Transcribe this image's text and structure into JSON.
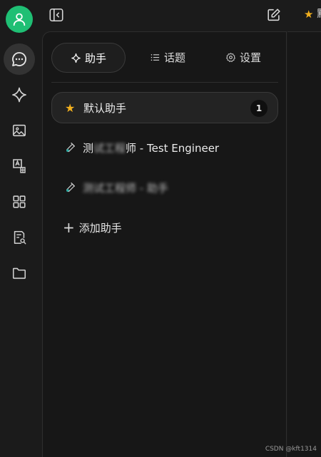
{
  "rail": {
    "items": [
      {
        "icon": "chat-icon",
        "active": true
      },
      {
        "icon": "sparkle-icon"
      },
      {
        "icon": "image-icon"
      },
      {
        "icon": "translate-icon"
      },
      {
        "icon": "apps-grid-icon"
      },
      {
        "icon": "document-search-icon"
      },
      {
        "icon": "folder-icon"
      }
    ]
  },
  "topbar": {
    "current_assistant_star": "★",
    "current_assistant_label_clipped": "默"
  },
  "tabs": [
    {
      "label": "助手",
      "icon": "sparkle-icon",
      "active": true
    },
    {
      "label": "话题",
      "icon": "list-icon"
    },
    {
      "label": "设置",
      "icon": "gear-icon"
    }
  ],
  "assistants": [
    {
      "icon": "★",
      "label": "默认助手",
      "badge": "1",
      "selected": true
    },
    {
      "icon": "test-tube-icon",
      "label_visible_prefix": "测",
      "label_blurred": "试工程",
      "label_visible_suffix": "师 - Test Engineer"
    },
    {
      "icon": "test-tube-icon",
      "label_blurred": "测试工程师 - 助手"
    }
  ],
  "add_assistant_label": "添加助手",
  "watermark": "CSDN @kft1314",
  "colors": {
    "accent_green": "#1fbf74",
    "star_yellow": "#f2b01e",
    "background": "#1b1b1b",
    "panel": "#171717"
  }
}
